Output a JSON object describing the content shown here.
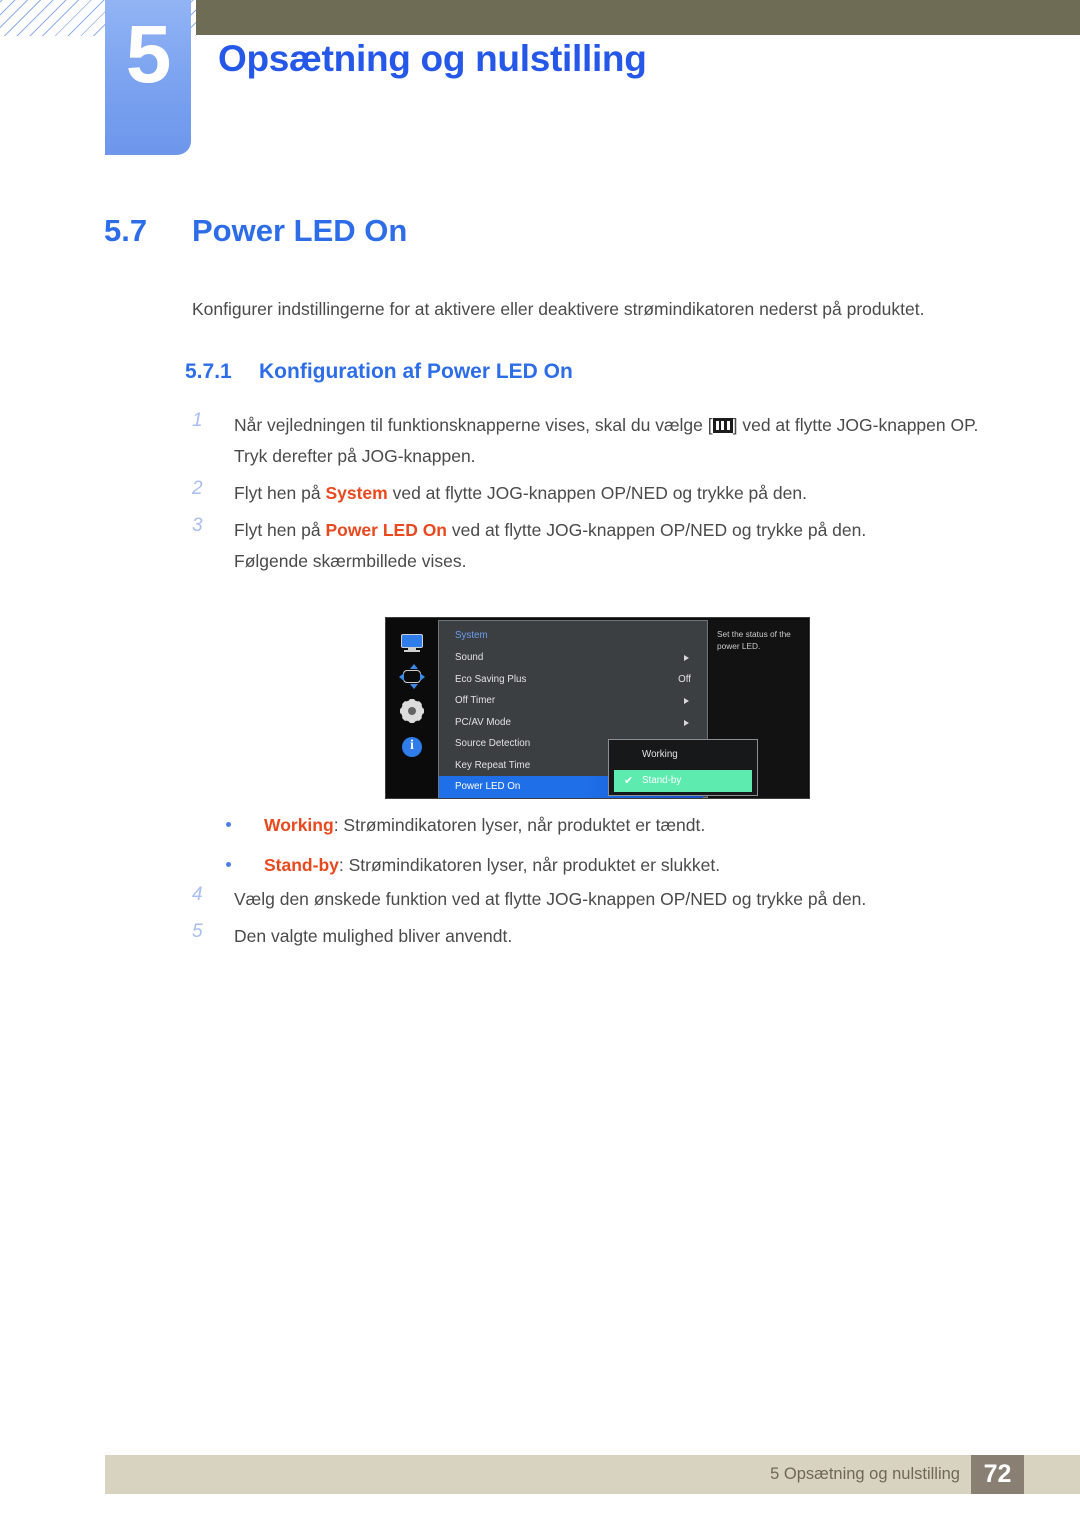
{
  "header": {
    "chapter_number": "5",
    "chapter_title": "Opsætning og nulstilling",
    "colors": {
      "badge_blue": "#7ea5f0",
      "olive_bar": "#6f6c55",
      "title_blue": "#2558e8"
    }
  },
  "section": {
    "number": "5.7",
    "title": "Power LED On",
    "intro": "Konfigurer indstillingerne for at aktivere eller deaktivere strømindikatoren nederst på produktet.",
    "sub_number": "5.7.1",
    "sub_title": "Konfiguration af Power LED On"
  },
  "steps_top": [
    {
      "marker": "1",
      "text_before": "Når vejledningen til funktionsknapperne vises, skal du vælge [",
      "icon": "menu-glyph-icon",
      "text_after": "] ved at flytte JOG-knappen OP.",
      "continuation": "Tryk derefter på JOG-knappen."
    },
    {
      "marker": "2",
      "text_before": "Flyt hen på ",
      "keyword": "System",
      "text_after": " ved at flytte JOG-knappen OP/NED og trykke på den.",
      "continuation": ""
    },
    {
      "marker": "3",
      "text_before": "Flyt hen på ",
      "keyword": "Power LED On",
      "text_after": " ved at flytte JOG-knappen OP/NED og trykke på den.",
      "continuation": "Følgende skærmbillede vises."
    }
  ],
  "steps_bottom": [
    {
      "marker": "4",
      "text": "Vælg den ønskede funktion ved at flytte JOG-knappen OP/NED og trykke på den."
    },
    {
      "marker": "5",
      "text": "Den valgte mulighed bliver anvendt."
    }
  ],
  "bullets": [
    {
      "keyword": "Working",
      "text": ": Strømindikatoren lyser, når produktet er tændt."
    },
    {
      "keyword": "Stand-by",
      "text": ": Strømindikatoren lyser, når produktet er slukket."
    }
  ],
  "osd": {
    "sidebar_icons": [
      "monitor-icon",
      "resize-arrows-icon",
      "gear-icon",
      "info-icon"
    ],
    "menu_title": "System",
    "rows": [
      {
        "label": "Sound",
        "value": "",
        "arrow": true
      },
      {
        "label": "Eco Saving Plus",
        "value": "Off",
        "arrow": false
      },
      {
        "label": "Off Timer",
        "value": "",
        "arrow": true
      },
      {
        "label": "PC/AV Mode",
        "value": "",
        "arrow": true
      },
      {
        "label": "Source Detection",
        "value": "",
        "arrow": false
      },
      {
        "label": "Key Repeat Time",
        "value": "",
        "arrow": false
      },
      {
        "label": "Power LED On",
        "value": "",
        "arrow": false,
        "selected": true
      }
    ],
    "submenu": [
      {
        "label": "Working",
        "checked": false
      },
      {
        "label": "Stand-by",
        "checked": true,
        "check_glyph": "✔"
      }
    ],
    "help_text": "Set the status of the power LED.",
    "colors": {
      "selected_blue": "#1f6fe8",
      "checked_green": "#5debb0",
      "menu_bg": "#3b3f42",
      "panel_bg": "#0c0c0c"
    }
  },
  "footer": {
    "text": "5 Opsætning og nulstilling",
    "page_number": "72"
  }
}
